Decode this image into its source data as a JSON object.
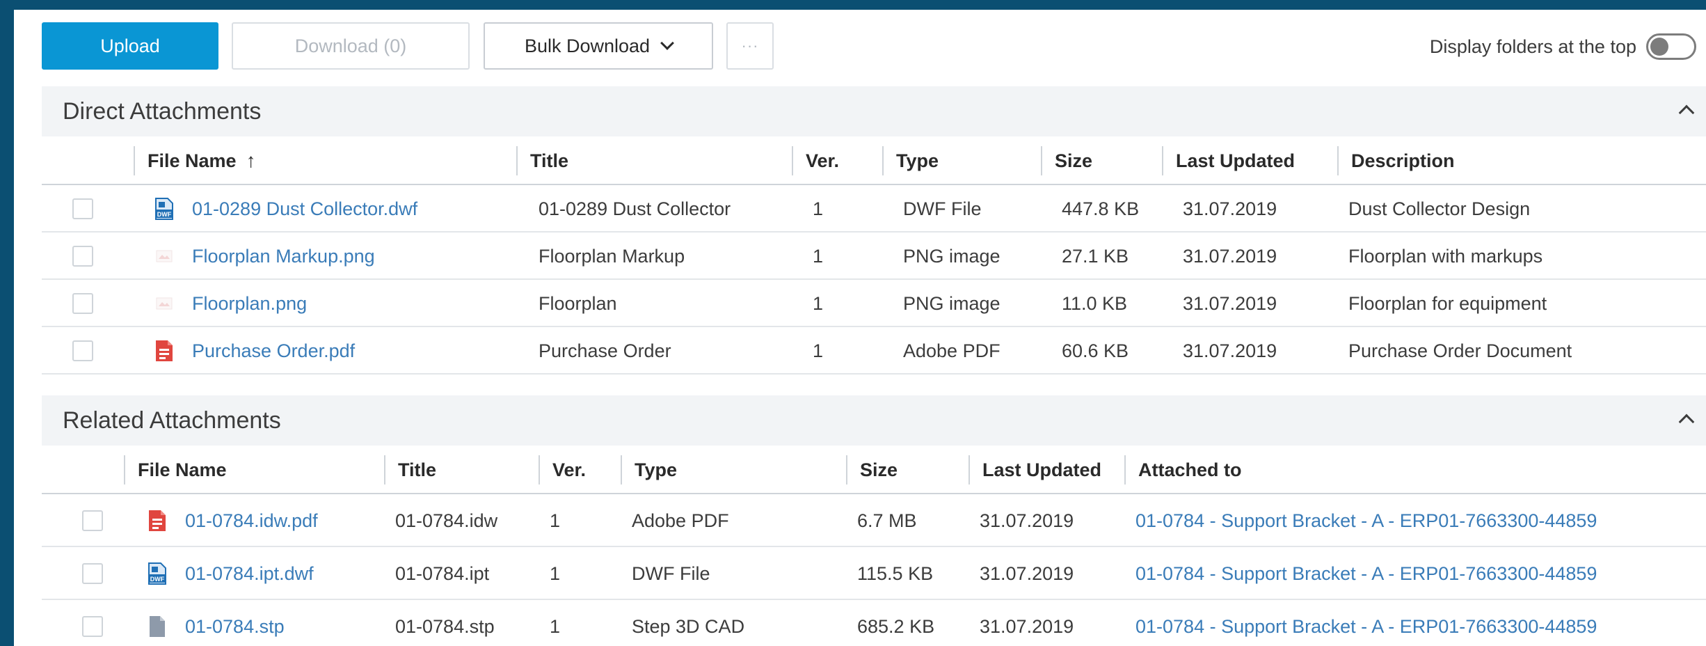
{
  "toolbar": {
    "upload_label": "Upload",
    "download_label": "Download (0)",
    "bulk_label": "Bulk Download",
    "more_label": "···",
    "toggle_label": "Display folders at the top",
    "toggle_on": false
  },
  "direct": {
    "title": "Direct Attachments",
    "columns": [
      "File Name",
      "Title",
      "Ver.",
      "Type",
      "Size",
      "Last Updated",
      "Description"
    ],
    "sort_indicator": "↑",
    "rows": [
      {
        "icon": "dwf-file-icon",
        "file": "01-0289 Dust Collector.dwf",
        "title": "01-0289 Dust Collector",
        "ver": "1",
        "type": "DWF File",
        "size": "447.8 KB",
        "updated": "31.07.2019",
        "desc": "Dust Collector Design"
      },
      {
        "icon": "png-image-icon",
        "file": "Floorplan Markup.png",
        "title": "Floorplan Markup",
        "ver": "1",
        "type": "PNG image",
        "size": "27.1 KB",
        "updated": "31.07.2019",
        "desc": "Floorplan with markups"
      },
      {
        "icon": "png-image-icon",
        "file": "Floorplan.png",
        "title": "Floorplan",
        "ver": "1",
        "type": "PNG image",
        "size": "11.0 KB",
        "updated": "31.07.2019",
        "desc": "Floorplan for equipment"
      },
      {
        "icon": "pdf-file-icon",
        "file": "Purchase Order.pdf",
        "title": "Purchase Order",
        "ver": "1",
        "type": "Adobe PDF",
        "size": "60.6 KB",
        "updated": "31.07.2019",
        "desc": "Purchase Order Document"
      }
    ]
  },
  "related": {
    "title": "Related Attachments",
    "columns": [
      "File Name",
      "Title",
      "Ver.",
      "Type",
      "Size",
      "Last Updated",
      "Attached to"
    ],
    "rows": [
      {
        "icon": "pdf-file-icon",
        "file": "01-0784.idw.pdf",
        "title": "01-0784.idw",
        "ver": "1",
        "type": "Adobe PDF",
        "size": "6.7 MB",
        "updated": "31.07.2019",
        "attached": "01-0784 - Support Bracket - A - ERP01-7663300-44859"
      },
      {
        "icon": "dwf-file-icon",
        "file": "01-0784.ipt.dwf",
        "title": "01-0784.ipt",
        "ver": "1",
        "type": "DWF File",
        "size": "115.5 KB",
        "updated": "31.07.2019",
        "attached": "01-0784 - Support Bracket - A - ERP01-7663300-44859"
      },
      {
        "icon": "generic-file-icon",
        "file": "01-0784.stp",
        "title": "01-0784.stp",
        "ver": "1",
        "type": "Step 3D CAD",
        "size": "685.2 KB",
        "updated": "31.07.2019",
        "attached": "01-0784 - Support Bracket - A - ERP01-7663300-44859"
      }
    ]
  },
  "colors": {
    "frame": "#0b4f72",
    "primary": "#0a96d4",
    "link": "#3a7cb8",
    "pdf_red": "#e0463f",
    "dwf_blue": "#1f6fb5"
  }
}
